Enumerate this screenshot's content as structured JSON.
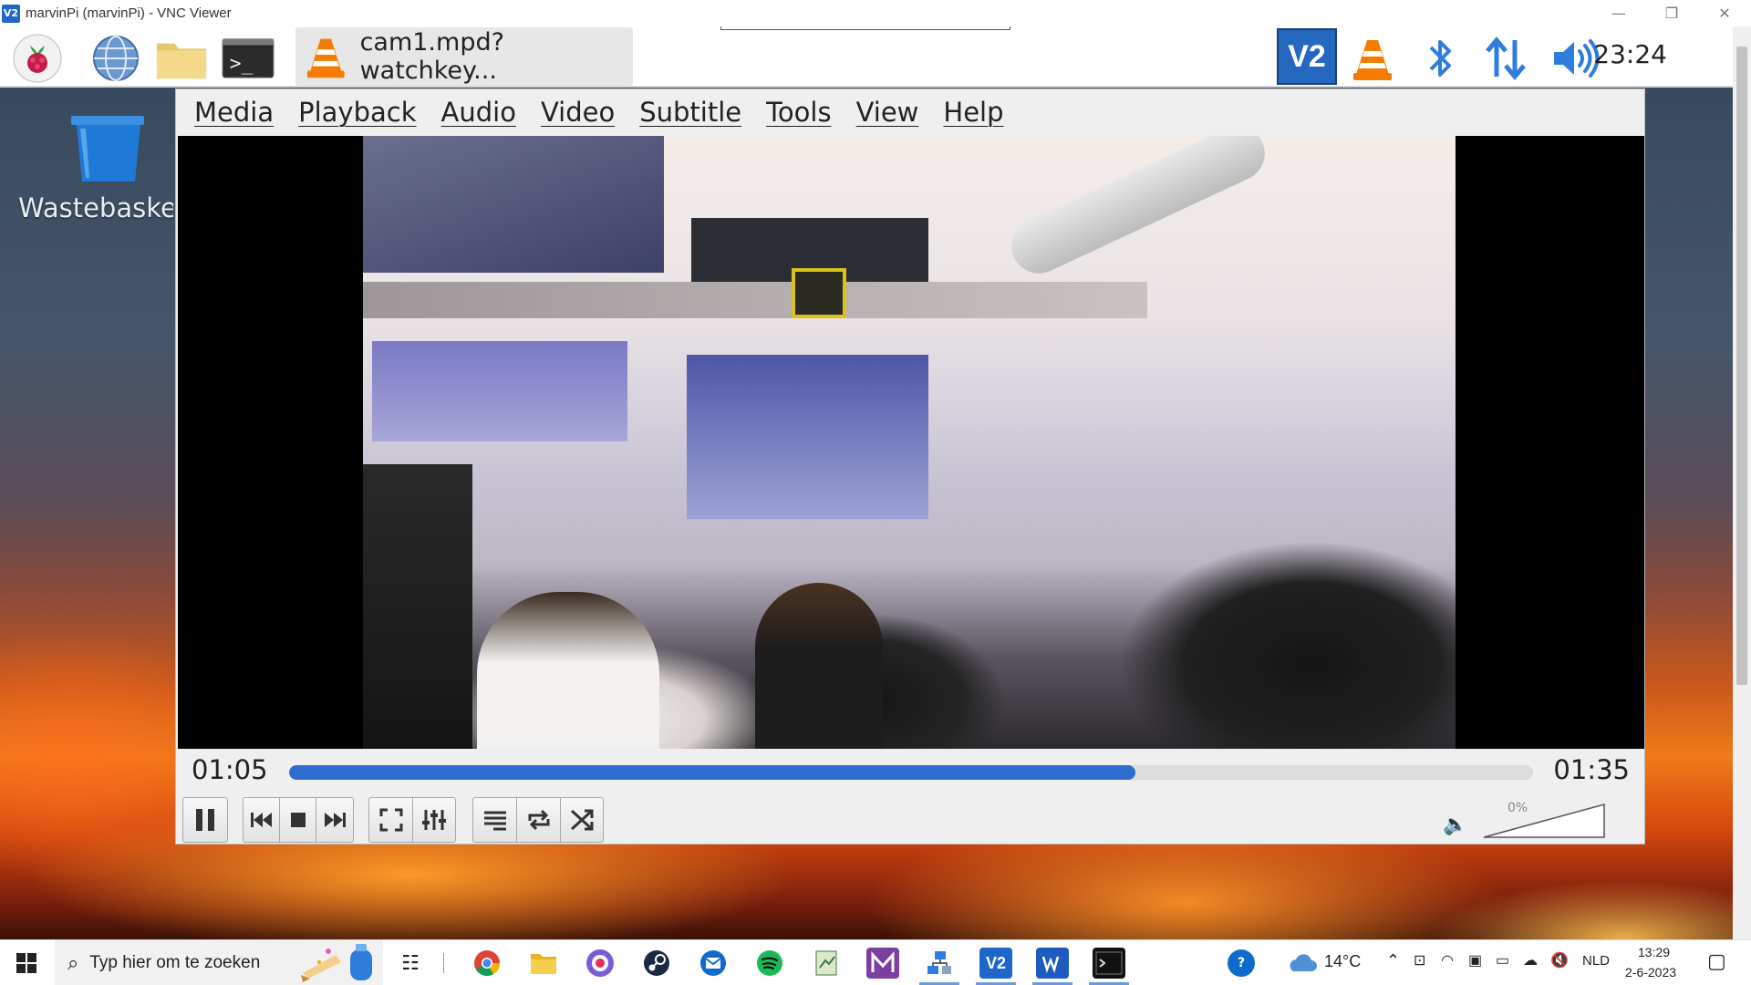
{
  "vnc_window": {
    "badge": "V2",
    "title": "marvinPi (marvinPi) - VNC Viewer",
    "minimize": "—",
    "restore": "❐",
    "close": "✕"
  },
  "pi_panel": {
    "task_label": "cam1.mpd?watchkey...",
    "clock": "23:24",
    "vnc_tray_badge": "V2"
  },
  "desktop": {
    "trash_label": "Wastebaske"
  },
  "vlc": {
    "menu": [
      "Media",
      "Playback",
      "Audio",
      "Video",
      "Subtitle",
      "Tools",
      "View",
      "Help"
    ],
    "time_current": "01:05",
    "time_total": "01:35",
    "progress_fraction": 0.68,
    "volume_label": "0%",
    "volume_fraction": 0.0
  },
  "taskbar": {
    "search_placeholder": "Typ hier om te zoeken",
    "weather": "14°C",
    "language": "NLD",
    "time": "13:29",
    "date": "2-6-2023"
  },
  "colors": {
    "accent_blue": "#2d6dcf",
    "vnc_blue": "#1f66c9",
    "vlc_orange": "#f57c00"
  }
}
